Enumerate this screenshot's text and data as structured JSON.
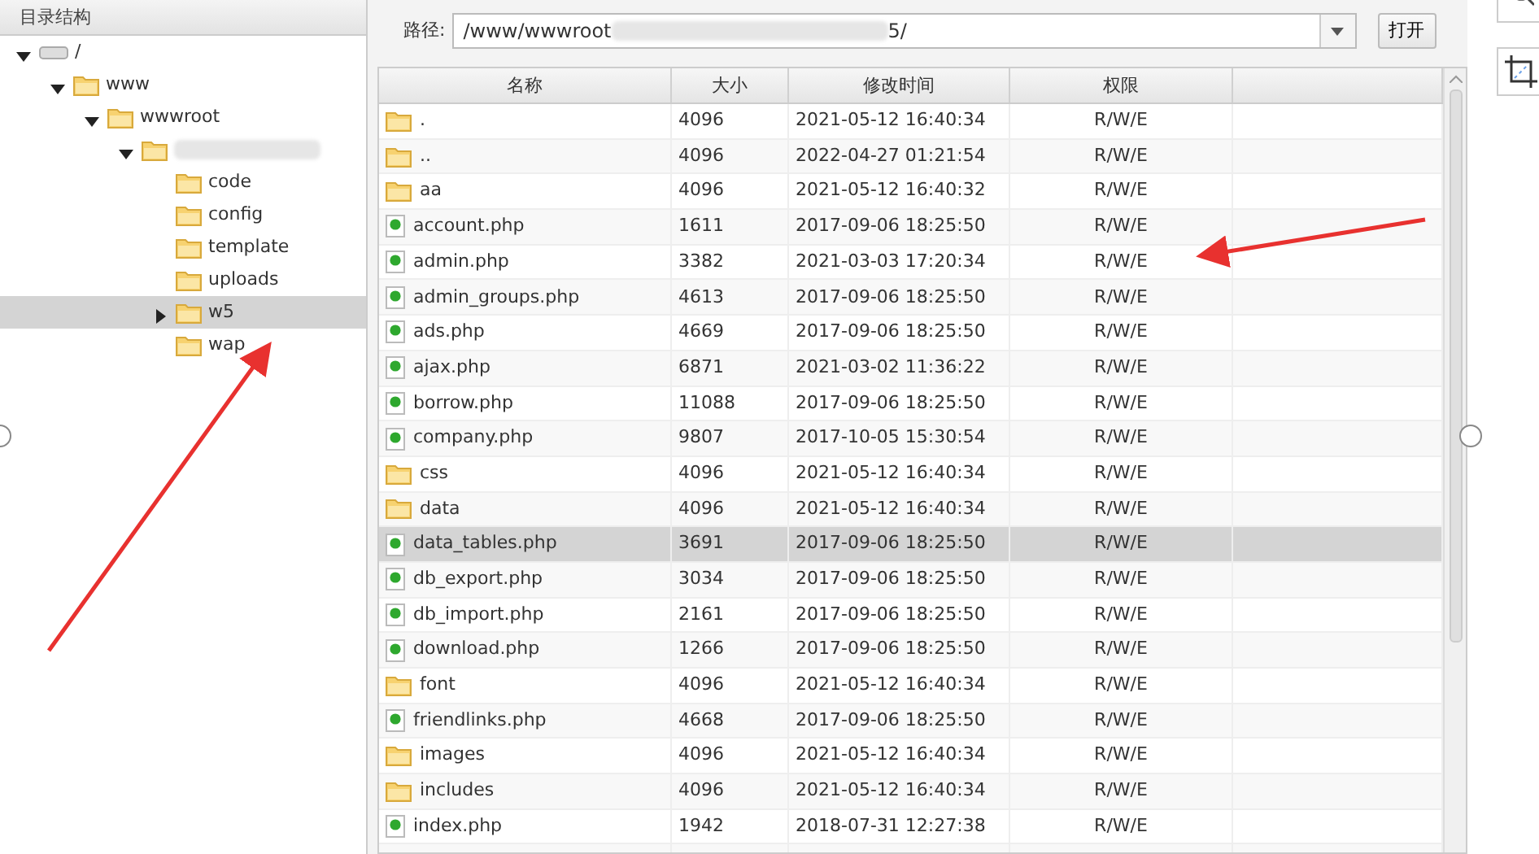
{
  "tree_panel": {
    "title": "目录结构",
    "tree": [
      {
        "name": "/",
        "kind": "drive",
        "expanded": true,
        "selected": false,
        "children": [
          {
            "name": "www",
            "kind": "folder",
            "expanded": true,
            "selected": false,
            "children": [
              {
                "name": "wwwroot",
                "kind": "folder",
                "expanded": true,
                "selected": false,
                "children": [
                  {
                    "kind": "folder",
                    "redacted": true,
                    "expanded": true,
                    "selected": false,
                    "children": [
                      {
                        "name": "code",
                        "kind": "folder",
                        "selected": false
                      },
                      {
                        "name": "config",
                        "kind": "folder",
                        "selected": false
                      },
                      {
                        "name": "template",
                        "kind": "folder",
                        "selected": false
                      },
                      {
                        "name": "uploads",
                        "kind": "folder",
                        "selected": false
                      },
                      {
                        "name": "w5",
                        "kind": "folder",
                        "expanded": false,
                        "selected": true
                      },
                      {
                        "name": "wap",
                        "kind": "folder",
                        "selected": false
                      }
                    ]
                  }
                ]
              }
            ]
          }
        ]
      }
    ]
  },
  "path_bar": {
    "label": "路径:",
    "value_start": "/www/wwwroot",
    "value_end": "5/",
    "button": "打开"
  },
  "table": {
    "columns": [
      "名称",
      "大小",
      "修改时间",
      "权限"
    ],
    "rows": [
      {
        "kind": "folder",
        "name": ".",
        "size": "4096",
        "modified": "2021-05-12 16:40:34",
        "permission": "R/W/E",
        "selected": false
      },
      {
        "kind": "folder",
        "name": "..",
        "size": "4096",
        "modified": "2022-04-27 01:21:54",
        "permission": "R/W/E",
        "selected": false
      },
      {
        "kind": "folder",
        "name": "aa",
        "size": "4096",
        "modified": "2021-05-12 16:40:32",
        "permission": "R/W/E",
        "selected": false
      },
      {
        "kind": "file",
        "name": "account.php",
        "size": "1611",
        "modified": "2017-09-06 18:25:50",
        "permission": "R/W/E",
        "selected": false
      },
      {
        "kind": "file",
        "name": "admin.php",
        "size": "3382",
        "modified": "2021-03-03 17:20:34",
        "permission": "R/W/E",
        "selected": false
      },
      {
        "kind": "file",
        "name": "admin_groups.php",
        "size": "4613",
        "modified": "2017-09-06 18:25:50",
        "permission": "R/W/E",
        "selected": false
      },
      {
        "kind": "file",
        "name": "ads.php",
        "size": "4669",
        "modified": "2017-09-06 18:25:50",
        "permission": "R/W/E",
        "selected": false
      },
      {
        "kind": "file",
        "name": "ajax.php",
        "size": "6871",
        "modified": "2021-03-02 11:36:22",
        "permission": "R/W/E",
        "selected": false
      },
      {
        "kind": "file",
        "name": "borrow.php",
        "size": "11088",
        "modified": "2017-09-06 18:25:50",
        "permission": "R/W/E",
        "selected": false
      },
      {
        "kind": "file",
        "name": "company.php",
        "size": "9807",
        "modified": "2017-10-05 15:30:54",
        "permission": "R/W/E",
        "selected": false
      },
      {
        "kind": "folder",
        "name": "css",
        "size": "4096",
        "modified": "2021-05-12 16:40:34",
        "permission": "R/W/E",
        "selected": false
      },
      {
        "kind": "folder",
        "name": "data",
        "size": "4096",
        "modified": "2021-05-12 16:40:34",
        "permission": "R/W/E",
        "selected": false
      },
      {
        "kind": "file",
        "name": "data_tables.php",
        "size": "3691",
        "modified": "2017-09-06 18:25:50",
        "permission": "R/W/E",
        "selected": true
      },
      {
        "kind": "file",
        "name": "db_export.php",
        "size": "3034",
        "modified": "2017-09-06 18:25:50",
        "permission": "R/W/E",
        "selected": false
      },
      {
        "kind": "file",
        "name": "db_import.php",
        "size": "2161",
        "modified": "2017-09-06 18:25:50",
        "permission": "R/W/E",
        "selected": false
      },
      {
        "kind": "file",
        "name": "download.php",
        "size": "1266",
        "modified": "2017-09-06 18:25:50",
        "permission": "R/W/E",
        "selected": false
      },
      {
        "kind": "folder",
        "name": "font",
        "size": "4096",
        "modified": "2021-05-12 16:40:34",
        "permission": "R/W/E",
        "selected": false
      },
      {
        "kind": "file",
        "name": "friendlinks.php",
        "size": "4668",
        "modified": "2017-09-06 18:25:50",
        "permission": "R/W/E",
        "selected": false
      },
      {
        "kind": "folder",
        "name": "images",
        "size": "4096",
        "modified": "2021-05-12 16:40:34",
        "permission": "R/W/E",
        "selected": false
      },
      {
        "kind": "folder",
        "name": "includes",
        "size": "4096",
        "modified": "2021-05-12 16:40:34",
        "permission": "R/W/E",
        "selected": false
      },
      {
        "kind": "file",
        "name": "index.php",
        "size": "1942",
        "modified": "2018-07-31 12:27:38",
        "permission": "R/W/E",
        "selected": false
      }
    ]
  }
}
